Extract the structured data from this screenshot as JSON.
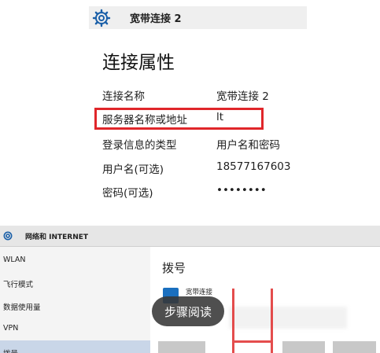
{
  "top_panel": {
    "header_title": "宽带连接 2",
    "header_icon": "gear-icon",
    "section_title": "连接属性",
    "properties": [
      {
        "key": "连接名称",
        "value": "宽带连接 2"
      },
      {
        "key": "服务器名称或地址",
        "value": "lt"
      },
      {
        "key": "登录信息的类型",
        "value": "用户名和密码"
      },
      {
        "key": "用户名(可选)",
        "value": "18577167603"
      },
      {
        "key": "密码(可选)",
        "value": "••••••••"
      }
    ],
    "highlight_color": "#e0262a"
  },
  "bottom_window": {
    "title": "网络和 INTERNET",
    "nav": [
      "WLAN",
      "飞行模式",
      "数据使用量",
      "VPN",
      "拨号"
    ],
    "content_title": "拨号",
    "connection_label": "宽带连接",
    "active_color": "#c9d6e8"
  },
  "overlay": {
    "label": "步骤阅读"
  }
}
